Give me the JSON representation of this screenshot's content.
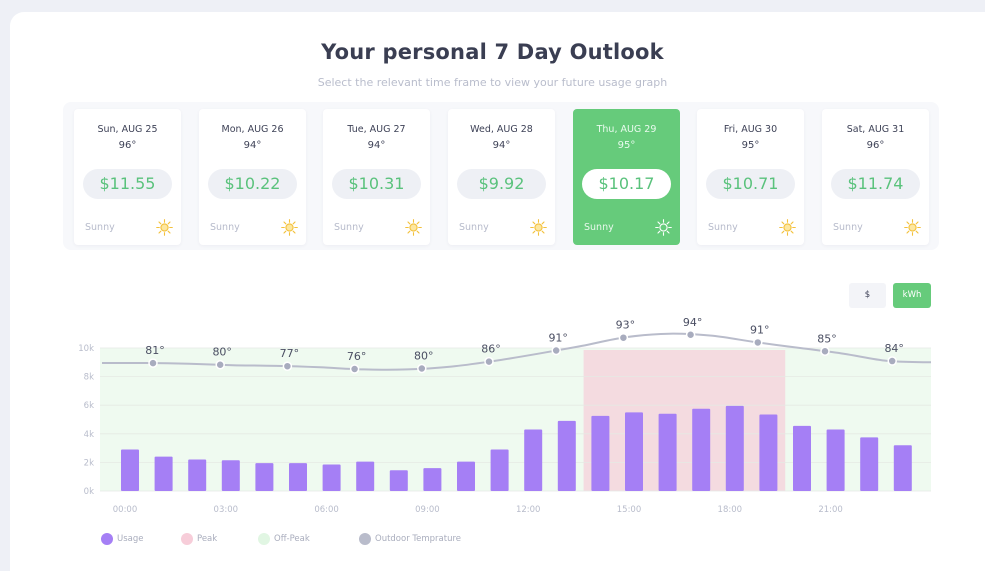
{
  "header": {
    "title": "Your personal 7 Day Outlook",
    "subtitle": "Select the relevant time frame to view your future usage graph"
  },
  "days": [
    {
      "date": "Sun, AUG 25",
      "temp": "96°",
      "price": "$11.55",
      "condition": "Sunny",
      "icon": "sun-icon",
      "selected": false
    },
    {
      "date": "Mon, AUG 26",
      "temp": "94°",
      "price": "$10.22",
      "condition": "Sunny",
      "icon": "sun-icon",
      "selected": false
    },
    {
      "date": "Tue, AUG 27",
      "temp": "94°",
      "price": "$10.31",
      "condition": "Sunny",
      "icon": "sun-icon",
      "selected": false
    },
    {
      "date": "Wed, AUG 28",
      "temp": "94°",
      "price": "$9.92",
      "condition": "Sunny",
      "icon": "sun-icon",
      "selected": false
    },
    {
      "date": "Thu, AUG 29",
      "temp": "95°",
      "price": "$10.17",
      "condition": "Sunny",
      "icon": "sun-icon",
      "selected": true
    },
    {
      "date": "Fri, AUG 30",
      "temp": "95°",
      "price": "$10.71",
      "condition": "Sunny",
      "icon": "sun-icon",
      "selected": false
    },
    {
      "date": "Sat, AUG 31",
      "temp": "96°",
      "price": "$11.74",
      "condition": "Sunny",
      "icon": "sun-icon",
      "selected": false
    }
  ],
  "toggle": {
    "dollar_label": "$",
    "kwh_label": "kWh",
    "active": "kWh"
  },
  "colors": {
    "accent_green": "#66cb7b",
    "price_green": "#5ac27c",
    "usage": "#a57ff5",
    "peak": "#f7cdd9",
    "off_peak": "#e1f6e3",
    "temperature": "#b9bccb"
  },
  "chart_data": {
    "type": "bar",
    "title": "",
    "xlabel": "",
    "ylabel": "",
    "ylim": [
      0,
      10000
    ],
    "y_ticks": [
      "0k",
      "2k",
      "4k",
      "6k",
      "8k",
      "10k"
    ],
    "x_ticks": [
      "00:00",
      "03:00",
      "06:00",
      "09:00",
      "12:00",
      "15:00",
      "18:00",
      "21:00"
    ],
    "grid": true,
    "legend_position": "bottom-left",
    "categories": [
      "00:00",
      "01:00",
      "02:00",
      "03:00",
      "04:00",
      "05:00",
      "06:00",
      "07:00",
      "08:00",
      "09:00",
      "10:00",
      "11:00",
      "12:00",
      "13:00",
      "14:00",
      "15:00",
      "16:00",
      "17:00",
      "18:00",
      "19:00",
      "20:00",
      "21:00",
      "22:00",
      "23:00"
    ],
    "series": [
      {
        "name": "Usage",
        "type": "bar",
        "values": [
          2900,
          2400,
          2200,
          2150,
          1950,
          1950,
          1850,
          2050,
          1450,
          1600,
          2050,
          2900,
          4300,
          4900,
          5250,
          5500,
          5400,
          5750,
          5950,
          5350,
          4550,
          4300,
          3750,
          3200
        ]
      }
    ],
    "temperature": {
      "name": "Outdoor Temprature",
      "labels": [
        "81°",
        "80°",
        "77°",
        "76°",
        "80°",
        "86°",
        "91°",
        "93°",
        "94°",
        "91°",
        "85°",
        "84°"
      ],
      "line_values": [
        8950,
        8950,
        8900,
        8800,
        8750,
        8650,
        8500,
        8500,
        8700,
        9100,
        9600,
        10150,
        10750,
        11000,
        10850,
        10400,
        10000,
        9600,
        9100,
        9000
      ]
    },
    "bands": [
      {
        "name": "Off-Peak",
        "range": [
          "00:00",
          "23:00"
        ]
      },
      {
        "name": "Peak",
        "range": [
          "14:00",
          "19:00"
        ]
      }
    ]
  },
  "legend": [
    {
      "label": "Usage",
      "color": "#a57ff5"
    },
    {
      "label": "Peak",
      "color": "#f7cdd9"
    },
    {
      "label": "Off-Peak",
      "color": "#e1f6e3"
    },
    {
      "label": "Outdoor Temprature",
      "color": "#b9bccb"
    }
  ]
}
